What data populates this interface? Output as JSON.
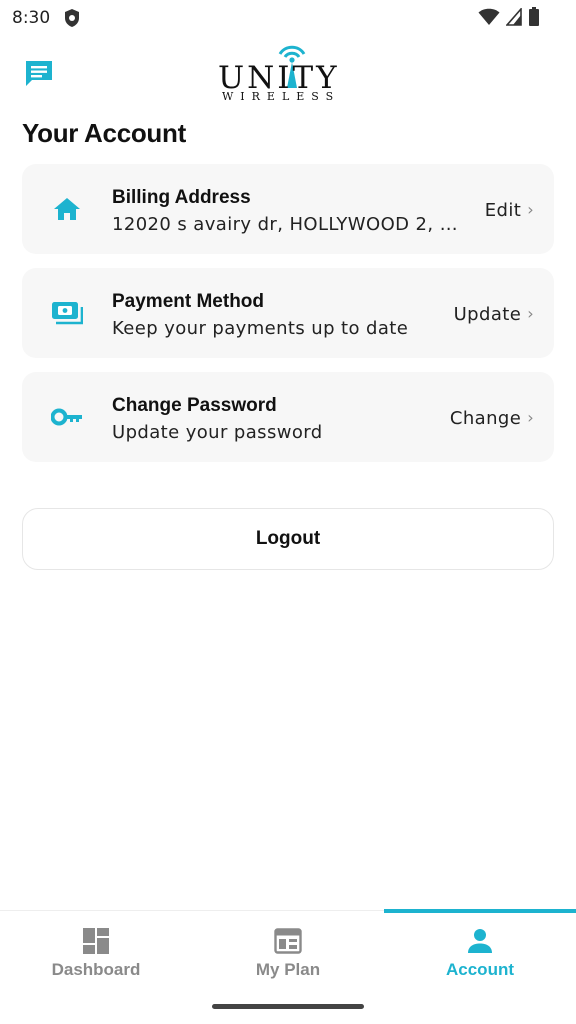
{
  "status_bar": {
    "time": "8:30"
  },
  "header": {
    "logo_main": "UNITY",
    "logo_sub": "WIRELESS"
  },
  "page": {
    "title": "Your Account"
  },
  "cards": [
    {
      "title": "Billing Address",
      "subtitle": "12020 s avairy dr, HOLLYWOOD 2, FL, ...",
      "action": "Edit",
      "icon": "home-icon"
    },
    {
      "title": "Payment Method",
      "subtitle": "Keep your payments up to date",
      "action": "Update",
      "icon": "payment-card-icon"
    },
    {
      "title": "Change Password",
      "subtitle": "Update your password",
      "action": "Change",
      "icon": "key-icon"
    }
  ],
  "logout": {
    "label": "Logout"
  },
  "bottom_nav": {
    "items": [
      {
        "label": "Dashboard",
        "icon": "dashboard-icon",
        "active": false
      },
      {
        "label": "My Plan",
        "icon": "plan-icon",
        "active": false
      },
      {
        "label": "Account",
        "icon": "person-icon",
        "active": true
      }
    ]
  },
  "colors": {
    "accent": "#1db3cf",
    "card_bg": "#f7f7f7",
    "inactive": "#8a8a8a"
  }
}
